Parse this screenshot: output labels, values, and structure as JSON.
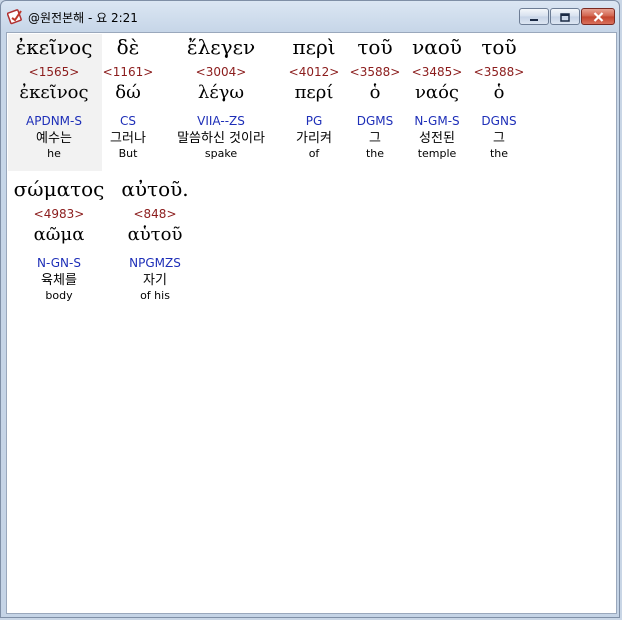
{
  "window": {
    "title": "@원전본해 - 요 2:21",
    "controls": [
      "minimize-icon",
      "maximize-icon",
      "close-icon"
    ]
  },
  "colors": {
    "strongs": "#8b1c1c",
    "parsing": "#1e2fb8",
    "selected_bg": "#f2f2f2"
  },
  "words": [
    {
      "greek": "ἐκεῖνος",
      "strongs": "<1565>",
      "lemma": "ἐκεῖνος",
      "parsing": "APDNM-S",
      "korean": "예수는",
      "english": "he"
    },
    {
      "greek": "δὲ",
      "strongs": "<1161>",
      "lemma": "δώ",
      "parsing": "CS",
      "korean": "그러나",
      "english": "But"
    },
    {
      "greek": "ἔλεγεν",
      "strongs": "<3004>",
      "lemma": "λέγω",
      "parsing": "VIIA--ZS",
      "korean": "말씀하신 것이라",
      "english": "spake"
    },
    {
      "greek": "περὶ",
      "strongs": "<4012>",
      "lemma": "περί",
      "parsing": "PG",
      "korean": "가리켜",
      "english": "of"
    },
    {
      "greek": "τοῦ",
      "strongs": "<3588>",
      "lemma": "ὁ",
      "parsing": "DGMS",
      "korean": "그",
      "english": "the"
    },
    {
      "greek": "ναοῦ",
      "strongs": "<3485>",
      "lemma": "ναός",
      "parsing": "N-GM-S",
      "korean": "성전된",
      "english": "temple"
    },
    {
      "greek": "τοῦ",
      "strongs": "<3588>",
      "lemma": "ὁ",
      "parsing": "DGNS",
      "korean": "그",
      "english": "the"
    },
    {
      "greek": "σώματος",
      "strongs": "<4983>",
      "lemma": "αῶμα",
      "parsing": "N-GN-S",
      "korean": "육체를",
      "english": "body"
    },
    {
      "greek": "αὐτοῦ.",
      "strongs": "<848>",
      "lemma": "αὑτοῦ",
      "parsing": "NPGMZS",
      "korean": "자기",
      "english": "of his"
    }
  ]
}
